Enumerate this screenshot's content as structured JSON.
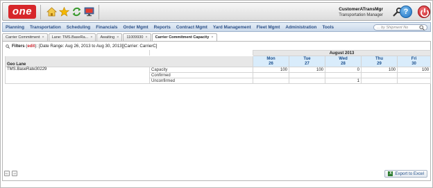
{
  "header": {
    "logo_text": "one",
    "user_name": "CustomerATransMgr",
    "user_role": "Transportation Manager"
  },
  "menu": {
    "items": [
      "Planning",
      "Transportation",
      "Scheduling",
      "Financials",
      "Order Mgmt",
      "Reports",
      "Contract Mgmt",
      "Yard Management",
      "Fleet Mgmt",
      "Administration",
      "Tools"
    ],
    "search_placeholder": "... by Shipment No"
  },
  "tabs": [
    {
      "label": "Carrier Commitment",
      "close": "×"
    },
    {
      "label": "Lane: TMS.BaseRa...",
      "close": "×"
    },
    {
      "label": "Awaiting",
      "close": "×"
    },
    {
      "label": "11009930",
      "close": "×"
    },
    {
      "label": "Carrier Commitment Capacity",
      "close": "×"
    }
  ],
  "filters": {
    "label": "Filters",
    "edit": "edit",
    "text": "[Date Range: Aug 26, 2013 to Aug 30, 2013][Carrier: CarrierC]"
  },
  "grid": {
    "month": "August 2013",
    "geo_header": "Geo Lane",
    "days": [
      {
        "dow": "Mon",
        "day": "26"
      },
      {
        "dow": "Tue",
        "day": "27"
      },
      {
        "dow": "Wed",
        "day": "28"
      },
      {
        "dow": "Thu",
        "day": "29"
      },
      {
        "dow": "Fri",
        "day": "30"
      }
    ],
    "lane": "TMS.BaseRate30229",
    "rows": [
      {
        "label": "Capacity",
        "values": [
          "100",
          "100",
          "0",
          "100",
          "100"
        ]
      },
      {
        "label": "Confirmed",
        "values": [
          "",
          "",
          "",
          "",
          ""
        ]
      },
      {
        "label": "Unconfirmed",
        "values": [
          "",
          "",
          "1",
          "",
          ""
        ]
      }
    ]
  },
  "footer": {
    "prev": "←",
    "next": "→",
    "export_label": "Export to Excel"
  }
}
